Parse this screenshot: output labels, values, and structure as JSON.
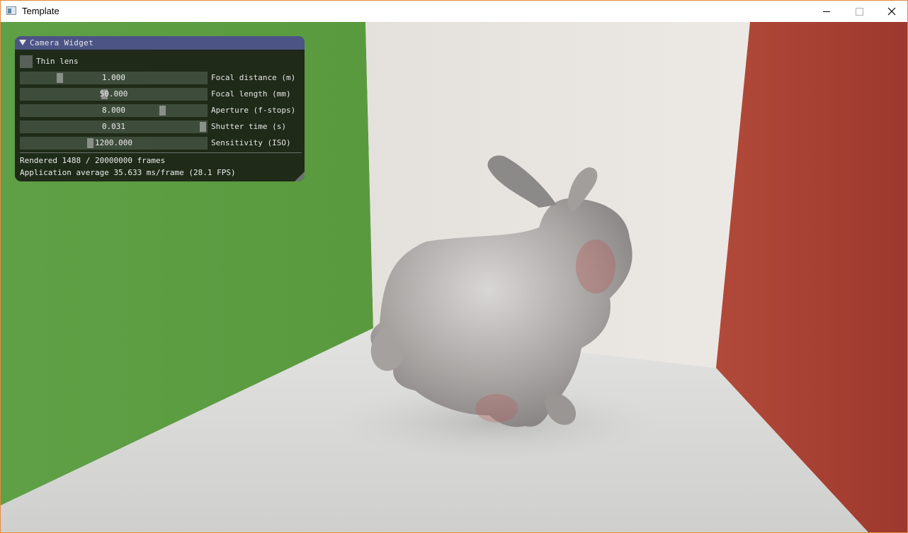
{
  "window": {
    "title": "Template",
    "accent": "#e38a3d"
  },
  "scene": {
    "description_icon": "rendered-cornell-box-bunny",
    "colors": {
      "left_wall": "#5a9f40",
      "right_wall": "#a63c30",
      "back_wall": "#e6e3df",
      "floor": "#d9d9d7",
      "bunny": "#b8b6b4"
    }
  },
  "camera_widget": {
    "title": "Camera Widget",
    "title_bg": "#4c5486",
    "thin_lens": {
      "label": "Thin lens",
      "checked": false
    },
    "sliders": [
      {
        "value": "1.000",
        "label": "Focal distance (m)",
        "grab_fraction": 0.2
      },
      {
        "value": "50.000",
        "label": "Focal length (mm)",
        "grab_fraction": 0.45
      },
      {
        "value": "8.000",
        "label": "Aperture (f-stops)",
        "grab_fraction": 0.775
      },
      {
        "value": "0.031",
        "label": "Shutter time (s)",
        "grab_fraction": 1.0
      },
      {
        "value": "1200.000",
        "label": "Sensitivity (ISO)",
        "grab_fraction": 0.37
      }
    ],
    "rendered_text": "Rendered 1488 / 20000000 frames",
    "average_text": "Application average 35.633 ms/frame (28.1 FPS)"
  }
}
